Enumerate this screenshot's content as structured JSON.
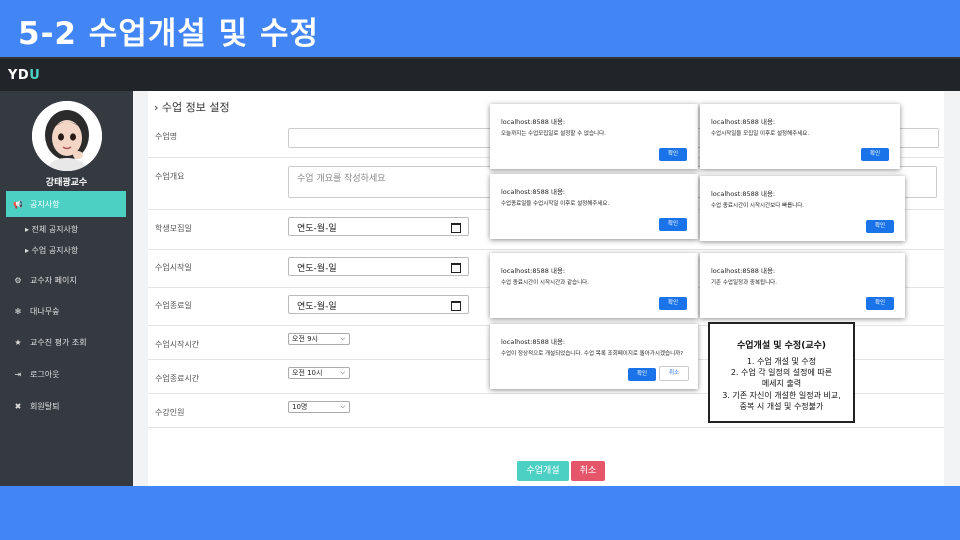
{
  "slide": {
    "title": "5-2 수업개설 및 수정"
  },
  "app": {
    "logo_main": "YD",
    "logo_accent": "U"
  },
  "profile": {
    "name": "강태광교수"
  },
  "sidebar": {
    "items": [
      {
        "label": "공지사항",
        "icon": "megaphone-icon",
        "glyph": "📢"
      },
      {
        "label": "교수자 페이지",
        "icon": "gears-icon",
        "glyph": "⚙"
      },
      {
        "label": "대나무숲",
        "icon": "bamboo-icon",
        "glyph": "✻"
      },
      {
        "label": "교수진 평가 조회",
        "icon": "star-icon",
        "glyph": "★"
      },
      {
        "label": "로그아웃",
        "icon": "logout-icon",
        "glyph": "⇥"
      },
      {
        "label": "회원탈퇴",
        "icon": "x-icon",
        "glyph": "✖"
      }
    ],
    "subitems": [
      {
        "label": "▸ 전체 공지사항"
      },
      {
        "label": "▸ 수업 공지사항"
      }
    ],
    "active_color": "#4dd0c4"
  },
  "form": {
    "section_title": "› 수업 정보 설정",
    "labels": {
      "name": "수업명",
      "overview": "수업개요",
      "recruit": "학생모집일",
      "start": "수업시작일",
      "end": "수업종료일",
      "start_time": "수업시작시간",
      "end_time": "수업종료시간",
      "capacity": "수강인원"
    },
    "overview_placeholder": "수업 개요를 작성하세요",
    "date_placeholder": "연도-월-일",
    "start_time_value": "오전 9시",
    "end_time_value": "오전 10시",
    "capacity_value": "10명",
    "submit_label": "수업개설",
    "cancel_label": "취소"
  },
  "dialogs": [
    {
      "header": "localhost:8588 내용:",
      "message": "오늘까지는 수업모집일로 설정할 수 없습니다.",
      "ok": "확인"
    },
    {
      "header": "localhost:8588 내용:",
      "message": "수업시작일을 모집일 이후로 설정해주세요.",
      "ok": "확인"
    },
    {
      "header": "localhost:8588 내용:",
      "message": "수업종료일을 수업시작일 이후로 설정해주세요.",
      "ok": "확인"
    },
    {
      "header": "localhost:8588 내용:",
      "message": "수업 종료시간이 시작시간보다 빠릅니다.",
      "ok": "확인"
    },
    {
      "header": "localhost:8588 내용:",
      "message": "수업 종료시간이 시작시간과 같습니다.",
      "ok": "확인"
    },
    {
      "header": "localhost:8588 내용:",
      "message": "기존 수업일정과 중복됩니다.",
      "ok": "확인"
    },
    {
      "header": "localhost:8588 내용:",
      "message": "수업이 정상적으로 개설되었습니다. 수업 목록 조회페이지로 돌아가시겠습니까?",
      "ok": "확인",
      "cancel": "취소"
    }
  ],
  "note": {
    "title": "수업개설 및 수정(교수)",
    "lines": [
      "1. 수업 개설 및 수정",
      "2. 수업 각 일정의 설정에 따른",
      "메세지 출력",
      "3. 기존 자신이 개설한 일정과 비교,",
      "중복 시 개설 및 수정불가"
    ]
  },
  "colors": {
    "slide_bg": "#4285f4",
    "topbar": "#212529",
    "sidebar": "#343a40",
    "accent": "#4dd0c4",
    "cancel": "#e5566b",
    "dialog_button": "#1a73e8"
  }
}
